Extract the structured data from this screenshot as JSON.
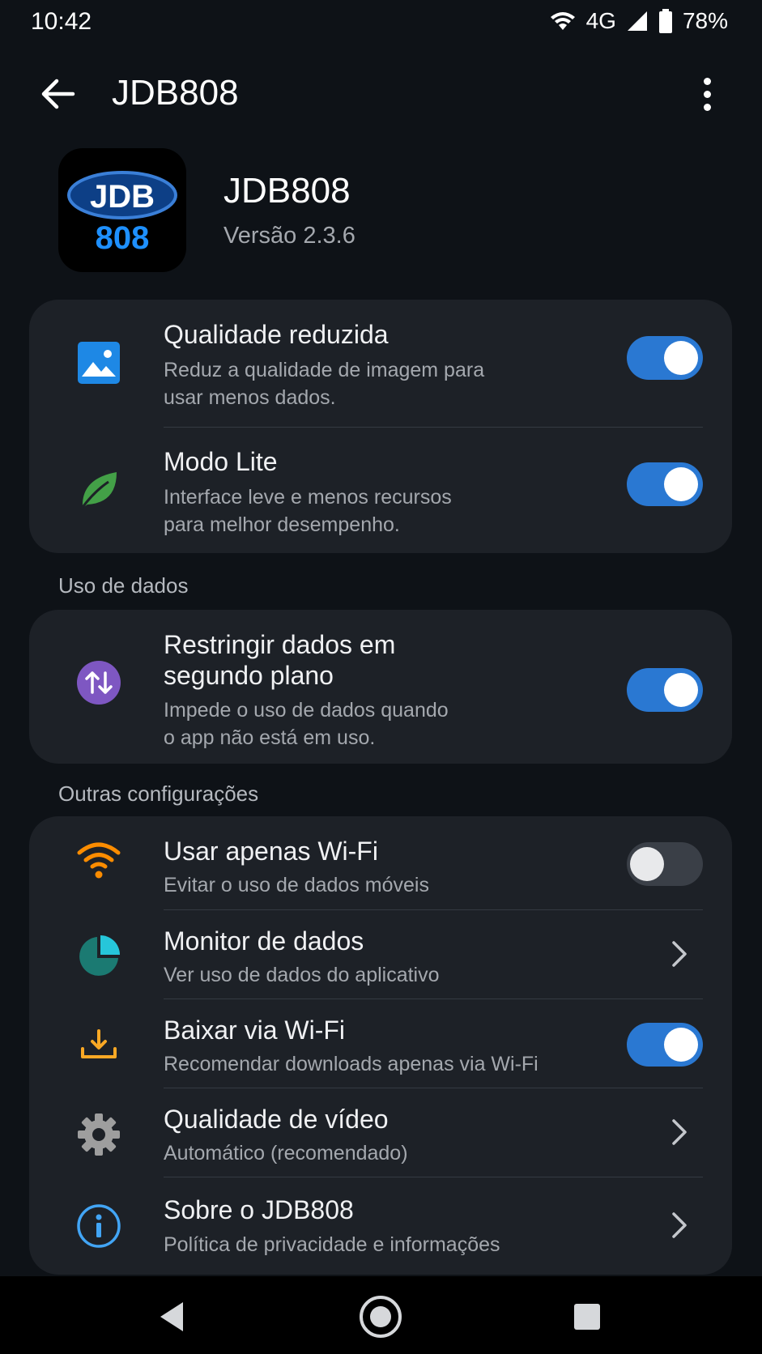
{
  "status_bar": {
    "time": "10:42",
    "network": "4G",
    "battery": "78%",
    "icons": [
      "wifi-icon",
      "signal-icon",
      "battery-icon"
    ]
  },
  "app_bar": {
    "title": "JDB808",
    "back_icon": "arrow-left-icon",
    "menu_icon": "more-vert-icon"
  },
  "app_header": {
    "logo_text_top": "JDB",
    "logo_text_bottom": "808",
    "name": "JDB808",
    "version": "Versão 2.3.6"
  },
  "card_top": {
    "items": [
      {
        "icon": "image-icon",
        "title": "Qualidade reduzida",
        "subtitle_lines": [
          "Reduz a qualidade de imagem para",
          "usar menos dados."
        ],
        "toggle": true
      },
      {
        "icon": "leaf-icon",
        "title": "Modo Lite",
        "subtitle_lines": [
          "Interface leve e menos recursos",
          "para melhor desempenho."
        ],
        "toggle": true
      }
    ]
  },
  "section_data": {
    "label": "Uso de dados",
    "items": [
      {
        "icon": "swap-vert-icon",
        "title_lines": [
          "Restringir dados em",
          "segundo plano"
        ],
        "subtitle_lines": [
          "Impede o uso de dados quando",
          "o app não está em uso."
        ],
        "toggle": true
      }
    ]
  },
  "section_other": {
    "label": "Outras configurações",
    "items": [
      {
        "icon": "wifi-icon",
        "title": "Usar apenas Wi-Fi",
        "subtitle": "Evitar o uso de dados móveis",
        "control": "toggle",
        "toggle": false
      },
      {
        "icon": "pie-chart-icon",
        "title": "Monitor de dados",
        "subtitle": "Ver uso de dados do aplicativo",
        "control": "chevron"
      },
      {
        "icon": "download-icon",
        "title": "Baixar via Wi-Fi",
        "subtitle": "Recomendar downloads apenas via Wi-Fi",
        "control": "toggle",
        "toggle": true
      },
      {
        "icon": "gear-icon",
        "title": "Qualidade de vídeo",
        "subtitle": "Automático (recomendado)",
        "control": "chevron"
      },
      {
        "icon": "info-icon",
        "title": "Sobre o JDB808",
        "subtitle": "Política de privacidade e informações",
        "control": "chevron"
      }
    ]
  },
  "colors": {
    "background": "#0e1217",
    "card": "#1d2127",
    "accent_toggle": "#2a78d2",
    "image_icon": "#1e88e5",
    "leaf_icon": "#43a047",
    "swap_icon_bg": "#7e57c2",
    "wifi_icon": "#fb8c00",
    "pie_icon": "#26a69a",
    "download_icon": "#f9a825",
    "gear_icon": "#9e9e9e",
    "info_icon": "#42a5f5"
  },
  "nav_bar": {
    "icons": [
      "nav-back-icon",
      "nav-home-icon",
      "nav-recents-icon"
    ]
  }
}
